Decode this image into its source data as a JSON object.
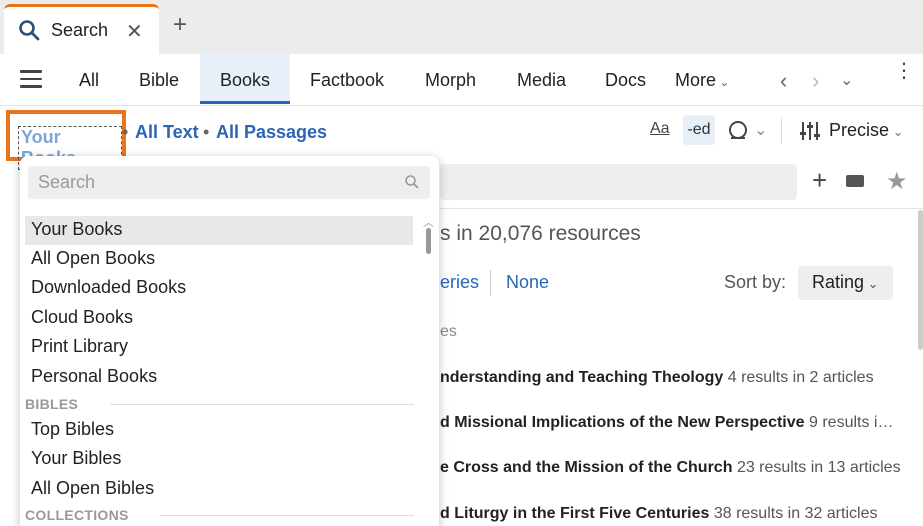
{
  "tab": {
    "title": "Search",
    "close_icon": "close-icon",
    "new_tab_icon": "plus-icon"
  },
  "nav": {
    "items": [
      "All",
      "Bible",
      "Books",
      "Factbook",
      "Morph",
      "Media",
      "Docs"
    ],
    "active": "Books",
    "more_label": "More",
    "menu_icon": "hamburger-icon"
  },
  "options": {
    "scope": "Your Books",
    "text_scope": "All Text",
    "passage_scope": "All Passages",
    "case_toggle": "Aa",
    "suffix_toggle": "-ed",
    "precision": "Precise"
  },
  "results": {
    "summary": "s in 20,076 resources",
    "series_link": "eries",
    "none_link": "None",
    "sort_label": "Sort by:",
    "sort_value": "Rating",
    "section_label": "es",
    "rows": [
      {
        "title": "nderstanding and Teaching Theology",
        "count": "4 results in 2 articles"
      },
      {
        "title": "d Missional Implications of the New Perspective",
        "count": "9 results i…"
      },
      {
        "title": "e Cross and the Mission of the Church",
        "count": "23 results in 13 articles"
      },
      {
        "title": "d Liturgy in the First Five Centuries",
        "count": "38 results in 32 articles"
      }
    ]
  },
  "dropdown": {
    "search_placeholder": "Search",
    "items": [
      "Your Books",
      "All Open Books",
      "Downloaded Books",
      "Cloud Books",
      "Print Library",
      "Personal Books"
    ],
    "selected": "Your Books",
    "section_bibles": "BIBLES",
    "bibles": [
      "Top Bibles",
      "Your Bibles",
      "All Open Bibles"
    ],
    "section_collections": "COLLECTIONS"
  },
  "colors": {
    "accent_orange": "#e8741e",
    "link_blue": "#2a66b5",
    "active_tab_bg": "#e8f1fa"
  }
}
